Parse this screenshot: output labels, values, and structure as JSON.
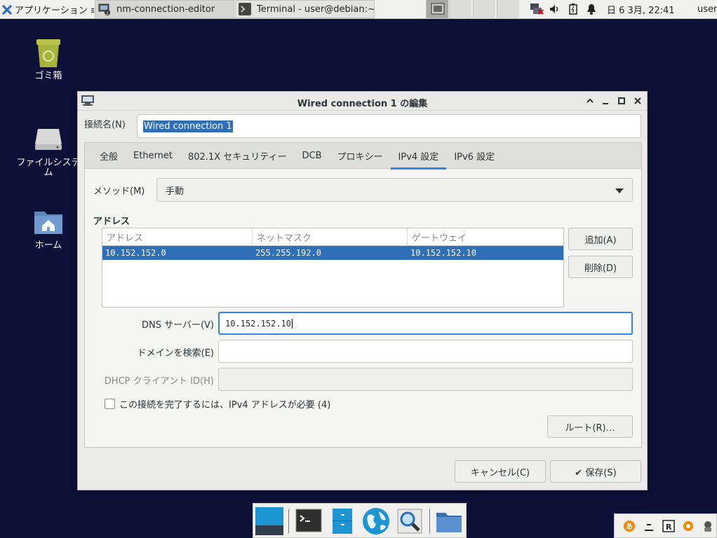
{
  "top_panel": {
    "apps_label": "アプリケーション ≡",
    "tasks": [
      {
        "label": "nm-connection-editor"
      },
      {
        "label": "Terminal - user@debian:~"
      }
    ],
    "clock": "日  6  3月, 22:41",
    "user": "user"
  },
  "desktop": {
    "icons": [
      {
        "label": "ゴミ箱"
      },
      {
        "label": "ファイルシステム"
      },
      {
        "label": "ホーム"
      }
    ]
  },
  "dialog": {
    "title": "Wired connection 1 の編集",
    "name_label": "接続名(N)",
    "name_value": "Wired connection 1",
    "tabs": [
      {
        "label": "全般"
      },
      {
        "label": "Ethernet"
      },
      {
        "label": "802.1X セキュリティー"
      },
      {
        "label": "DCB"
      },
      {
        "label": "プロキシー"
      },
      {
        "label": "IPv4 設定"
      },
      {
        "label": "IPv6 設定"
      }
    ],
    "active_tab": "IPv4 設定",
    "method_label": "メソッド(M)",
    "method_value": "手動",
    "address_section": "アドレス",
    "address_columns": [
      "アドレス",
      "ネットマスク",
      "ゲートウェイ"
    ],
    "address_rows": [
      [
        "10.152.152.0",
        "255.255.192.0",
        "10.152.152.10"
      ]
    ],
    "add_button": "追加(A)",
    "delete_button": "削除(D)",
    "dns_label": "DNS サーバー(V)",
    "dns_value": "10.152.152.10",
    "search_domain_label": "ドメインを検索(E)",
    "search_domain_value": "",
    "dhcp_id_label": "DHCP クライアント ID(H)",
    "dhcp_id_value": "",
    "require_ipv4_label": "この接続を完了するには、IPv4 アドレスが必要 (4)",
    "require_ipv4_checked": false,
    "routes_button": "ルート(R)…",
    "cancel_button": "キャンセル(C)",
    "save_button": "✔ 保存(S)"
  },
  "colors": {
    "desktop_bg": "#0d1137",
    "selection": "#2f6fb8",
    "accent": "#3584e4"
  }
}
